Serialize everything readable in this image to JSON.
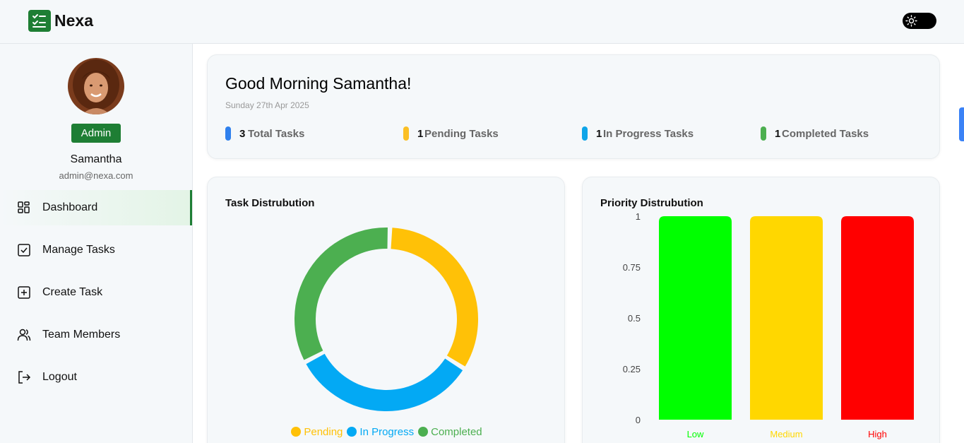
{
  "app": {
    "brand": "Nexa"
  },
  "user": {
    "role": "Admin",
    "name": "Samantha",
    "email": "admin@nexa.com"
  },
  "sidebar": {
    "items": [
      {
        "label": "Dashboard",
        "icon": "dashboard-grid-icon",
        "active": true
      },
      {
        "label": "Manage Tasks",
        "icon": "checkbox-icon",
        "active": false
      },
      {
        "label": "Create Task",
        "icon": "plus-square-icon",
        "active": false
      },
      {
        "label": "Team Members",
        "icon": "users-icon",
        "active": false
      },
      {
        "label": "Logout",
        "icon": "logout-icon",
        "active": false
      }
    ]
  },
  "greeting": {
    "title": "Good Morning Samantha!",
    "date": "Sunday 27th Apr 2025",
    "stats": [
      {
        "count": "3",
        "label": "Total Tasks",
        "color": "#2f80ed"
      },
      {
        "count": "1",
        "label": "Pending Tasks",
        "color": "#fbbf24"
      },
      {
        "count": "1",
        "label": "In Progress Tasks",
        "color": "#0ea5e9"
      },
      {
        "count": "1",
        "label": "Completed Tasks",
        "color": "#4caf50"
      }
    ]
  },
  "chart_data": [
    {
      "type": "pie",
      "title": "Task Distrubution",
      "categories": [
        "Pending",
        "In Progress",
        "Completed"
      ],
      "values": [
        1,
        1,
        1
      ],
      "colors": [
        "#ffc107",
        "#03a9f4",
        "#4caf50"
      ],
      "donut": true,
      "legend": "bottom"
    },
    {
      "type": "bar",
      "title": "Priority Distrubution",
      "categories": [
        "Low",
        "Medium",
        "High"
      ],
      "values": [
        1,
        1,
        1
      ],
      "colors": [
        "#00ff00",
        "#ffd700",
        "#ff0000"
      ],
      "ylim": [
        0,
        1
      ],
      "yticks": [
        "0",
        "0.25",
        "0.5",
        "0.75",
        "1"
      ],
      "grid": false,
      "legend": "none"
    }
  ],
  "colors": {
    "accent": "#1e7e34",
    "background": "#f5f8fa"
  }
}
